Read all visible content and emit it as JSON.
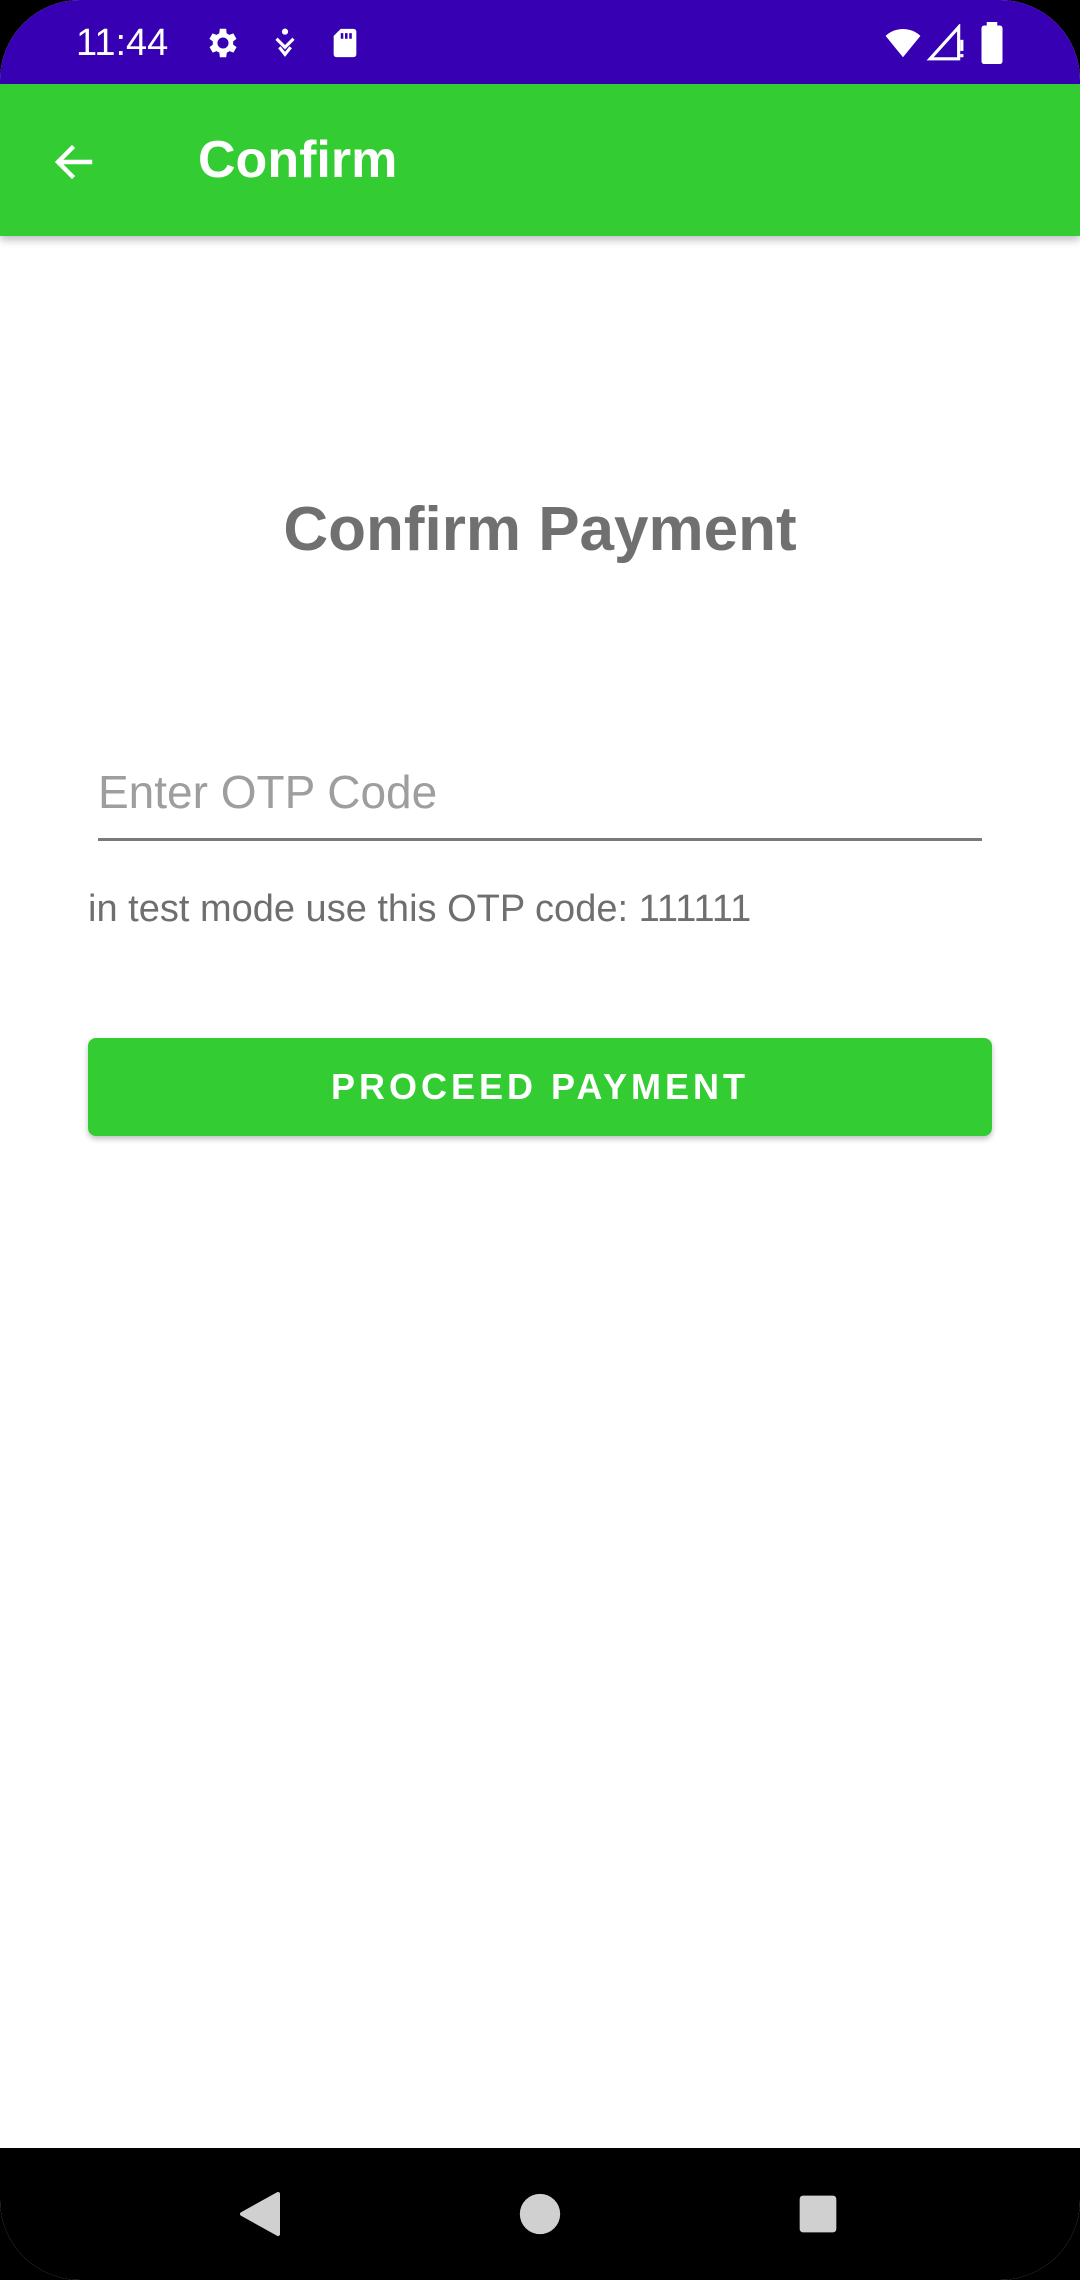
{
  "status_bar": {
    "time": "11:44",
    "icons_left": [
      "gear-icon",
      "accessibility-icon",
      "sd-card-icon"
    ],
    "icons_right": [
      "wifi-icon",
      "signal-alert-icon",
      "battery-icon"
    ],
    "color": "#3700b3"
  },
  "app_bar": {
    "title": "Confirm",
    "back_icon": "arrow-left-icon",
    "color": "#33cc33"
  },
  "main": {
    "heading": "Confirm Payment",
    "otp_field": {
      "placeholder": "Enter OTP Code",
      "value": ""
    },
    "hint": "in test mode use this OTP code: 111111",
    "proceed_button": "PROCEED PAYMENT"
  },
  "nav_bar": {
    "buttons": [
      "back-triangle-icon",
      "home-circle-icon",
      "recents-square-icon"
    ]
  }
}
